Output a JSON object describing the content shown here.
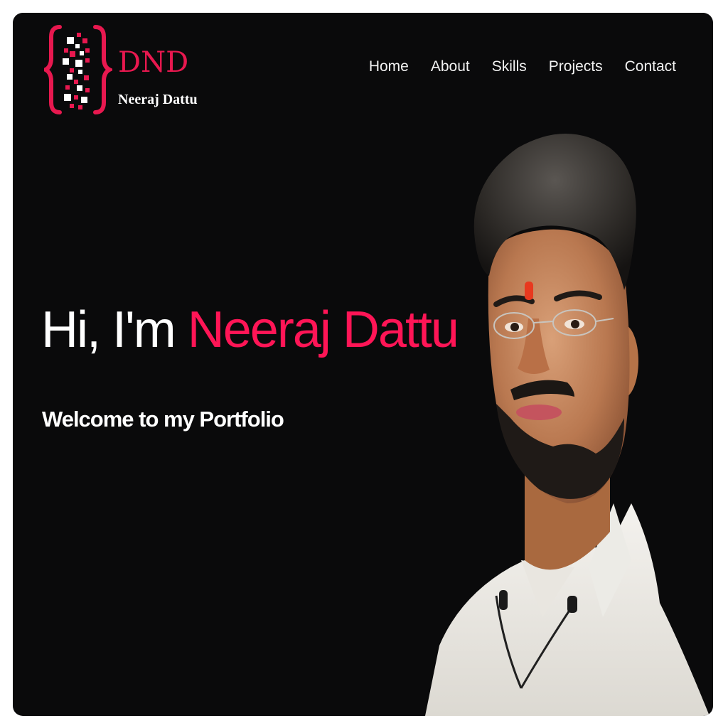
{
  "brand": {
    "abbr": "DND",
    "name": "Neeraj Dattu",
    "accent_color": "#e8184f",
    "icon": "code-brackets-pixel-icon"
  },
  "nav": {
    "items": [
      {
        "label": "Home"
      },
      {
        "label": "About"
      },
      {
        "label": "Skills"
      },
      {
        "label": "Projects"
      },
      {
        "label": "Contact"
      }
    ]
  },
  "hero": {
    "greeting": "Hi, I'm ",
    "name": "Neeraj Dattu",
    "subtitle": "Welcome to my Portfolio",
    "name_color": "#ff1556"
  },
  "portrait": {
    "icon": "profile-photo"
  },
  "colors": {
    "background": "#0a0a0b",
    "text": "#ffffff",
    "accent": "#ff1556"
  }
}
